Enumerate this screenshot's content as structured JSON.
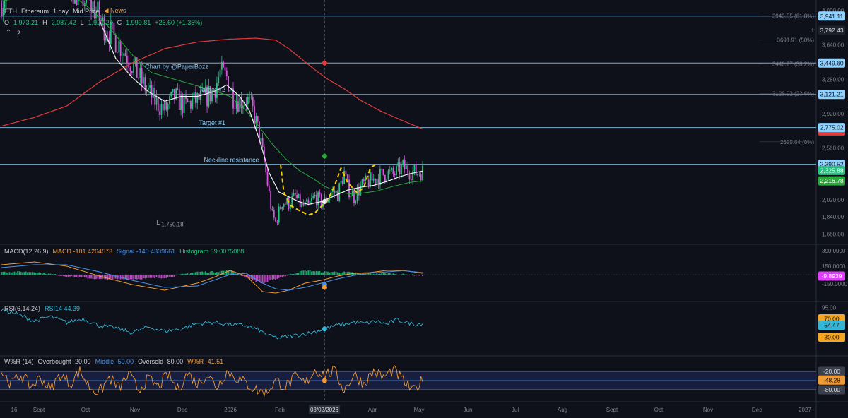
{
  "header": {
    "symbol": "ETH",
    "name": "Ethereum",
    "interval": "1 day",
    "price_type": "Mid Price",
    "news_label": "News",
    "ohlc": {
      "o_label": "O",
      "o": "1,973.21",
      "h_label": "H",
      "h": "2,087.42",
      "l_label": "L",
      "l": "1,921.24",
      "c_label": "C",
      "c": "1,999.81",
      "change": "+26.60 (+1.35%)"
    },
    "indicator_count": "2"
  },
  "macd": {
    "title": "MACD(12,26,9)",
    "macd_label": "MACD -101.4264573",
    "signal_label": "Signal -140.4339661",
    "hist_label": "Histogram 39.0075088"
  },
  "rsi": {
    "title": "RSI(6,14,24)",
    "value_label": "RSI14 44.39"
  },
  "wr": {
    "title": "W%R (14)",
    "overbought_label": "Overbought -20.00",
    "middle_label": "Middle -50.00",
    "oversold_label": "Oversold -80.00",
    "value_label": "W%R -41.51"
  },
  "colors": {
    "background": "#0f111a",
    "up": "#26c281",
    "down": "#d15ad6",
    "white_ma": "#f2f2f2",
    "green_ma": "#27a838",
    "red_ma": "#e23b3b",
    "macd": "#f09a36",
    "signal": "#4a90e2",
    "rsi": "#35b6d6",
    "wr": "#f09a36",
    "hline": "#8fc9ef",
    "pattern": "#f5d000"
  },
  "chart_data": [
    {
      "type": "candlestick",
      "title": "",
      "x_axis_labels": [
        "16",
        "Sept",
        "Oct",
        "Nov",
        "Dec",
        "2026",
        "Feb",
        "03/02/2026",
        "Apr",
        "May",
        "Jun",
        "Jul",
        "Aug",
        "Sept",
        "Oct",
        "Nov",
        "Dec",
        "2027"
      ],
      "crosshair_date": "03/02/2026",
      "y_tick_labels": [
        "4,000.00",
        "3,640.00",
        "3,280.00",
        "2,920.00",
        "2,560.00",
        "2,020.00",
        "1,840.00",
        "1,660.00"
      ],
      "ylim": [
        1560,
        4080
      ],
      "fib_levels": [
        {
          "label": "3943.55 (61.8%)",
          "value": 3943.55
        },
        {
          "label": "3691.91 (50%)",
          "value": 3691.91
        },
        {
          "label": "3440.27 (38.2%)",
          "value": 3440.27
        },
        {
          "label": "3128.92 (23.6%)",
          "value": 3128.92
        },
        {
          "label": "2625.64 (0%)",
          "value": 2625.64
        }
      ],
      "horizontal_levels": [
        {
          "value": 3941.11,
          "label": "3,941.11"
        },
        {
          "value": 3449.6,
          "label": "3,449.60"
        },
        {
          "value": 3121.21,
          "label": "3,121.21"
        },
        {
          "value": 2775.02,
          "label": "2,775.02"
        },
        {
          "value": 2390.52,
          "label": "2,390.52"
        }
      ],
      "price_tags": [
        {
          "value": 3792.43,
          "label": "3,792.43"
        },
        {
          "value": 2325.88,
          "label": "2,325.88"
        },
        {
          "value": 2216.78,
          "label": "2,216.78"
        }
      ],
      "annotations": [
        {
          "text": "Chart by @PaperBozz",
          "x_index": 88,
          "y": 3390
        },
        {
          "text": "Target #2",
          "x_index": 121,
          "y": 3150
        },
        {
          "text": "Target #1",
          "x_index": 121,
          "y": 2800
        },
        {
          "text": "Neckline resistance",
          "x_index": 124,
          "y": 2415
        },
        {
          "text": "1,750.18",
          "x_index": 98,
          "y": 1740
        }
      ],
      "x_months": [
        {
          "label": "16",
          "index": 0
        },
        {
          "label": "Sept",
          "index": 15
        },
        {
          "label": "Oct",
          "index": 45
        },
        {
          "label": "Nov",
          "index": 76
        },
        {
          "label": "Dec",
          "index": 106
        },
        {
          "label": "2026",
          "index": 137
        },
        {
          "label": "Feb",
          "index": 168
        },
        {
          "label": "Mar",
          "index": 196
        },
        {
          "label": "Apr",
          "index": 227
        },
        {
          "label": "May",
          "index": 257
        }
      ],
      "projection_months": [
        "Jun",
        "Jul",
        "Aug",
        "Sept",
        "Oct",
        "Nov",
        "Dec",
        "2027"
      ],
      "price_key_points": [
        [
          0,
          4100
        ],
        [
          8,
          4300
        ],
        [
          20,
          4450
        ],
        [
          30,
          4500
        ],
        [
          40,
          4300
        ],
        [
          48,
          4150
        ],
        [
          56,
          4050
        ],
        [
          62,
          3850
        ],
        [
          70,
          3700
        ],
        [
          78,
          3500
        ],
        [
          86,
          3250
        ],
        [
          94,
          3050
        ],
        [
          100,
          2950
        ],
        [
          106,
          3100
        ],
        [
          112,
          3000
        ],
        [
          118,
          3050
        ],
        [
          124,
          3080
        ],
        [
          130,
          3150
        ],
        [
          134,
          3350
        ],
        [
          138,
          3300
        ],
        [
          142,
          3100
        ],
        [
          146,
          3050
        ],
        [
          150,
          3080
        ],
        [
          154,
          2950
        ],
        [
          158,
          2700
        ],
        [
          162,
          2300
        ],
        [
          166,
          1850
        ],
        [
          168,
          1780
        ],
        [
          172,
          2000
        ],
        [
          176,
          1980
        ],
        [
          180,
          2050
        ],
        [
          184,
          1950
        ],
        [
          188,
          1950
        ],
        [
          192,
          2050
        ],
        [
          196,
          1990
        ],
        [
          198,
          2000
        ],
        [
          202,
          2100
        ],
        [
          206,
          2080
        ],
        [
          210,
          2300
        ],
        [
          212,
          2150
        ],
        [
          216,
          2050
        ],
        [
          220,
          2150
        ],
        [
          224,
          2200
        ],
        [
          230,
          2250
        ],
        [
          236,
          2300
        ],
        [
          240,
          2280
        ],
        [
          246,
          2360
        ],
        [
          250,
          2320
        ],
        [
          254,
          2300
        ],
        [
          258,
          2320
        ]
      ],
      "ma_white_key": [
        [
          60,
          3900
        ],
        [
          70,
          3500
        ],
        [
          80,
          3300
        ],
        [
          90,
          3150
        ],
        [
          100,
          3050
        ],
        [
          110,
          3100
        ],
        [
          120,
          3100
        ],
        [
          130,
          3150
        ],
        [
          138,
          3220
        ],
        [
          146,
          3100
        ],
        [
          152,
          2950
        ],
        [
          158,
          2650
        ],
        [
          164,
          2300
        ],
        [
          170,
          2100
        ],
        [
          176,
          2050
        ],
        [
          182,
          2000
        ],
        [
          188,
          1970
        ],
        [
          196,
          2000
        ],
        [
          204,
          2060
        ],
        [
          212,
          2120
        ],
        [
          220,
          2150
        ],
        [
          228,
          2170
        ],
        [
          236,
          2210
        ],
        [
          244,
          2260
        ],
        [
          250,
          2290
        ],
        [
          258,
          2320
        ]
      ],
      "ma_green_key": [
        [
          0,
          4100
        ],
        [
          20,
          4150
        ],
        [
          40,
          4200
        ],
        [
          52,
          4050
        ],
        [
          62,
          3900
        ],
        [
          72,
          3700
        ],
        [
          82,
          3500
        ],
        [
          92,
          3350
        ],
        [
          102,
          3300
        ],
        [
          112,
          3250
        ],
        [
          122,
          3200
        ],
        [
          132,
          3150
        ],
        [
          140,
          3100
        ],
        [
          150,
          2950
        ],
        [
          158,
          2780
        ],
        [
          166,
          2600
        ],
        [
          174,
          2450
        ],
        [
          182,
          2330
        ],
        [
          190,
          2250
        ],
        [
          198,
          2160
        ],
        [
          206,
          2100
        ],
        [
          214,
          2080
        ],
        [
          222,
          2090
        ],
        [
          230,
          2110
        ],
        [
          240,
          2160
        ],
        [
          250,
          2200
        ],
        [
          258,
          2217
        ]
      ],
      "ma_red_key": [
        [
          0,
          2790
        ],
        [
          20,
          2880
        ],
        [
          40,
          3000
        ],
        [
          60,
          3250
        ],
        [
          80,
          3450
        ],
        [
          100,
          3600
        ],
        [
          120,
          3670
        ],
        [
          140,
          3700
        ],
        [
          156,
          3710
        ],
        [
          168,
          3690
        ],
        [
          176,
          3600
        ],
        [
          184,
          3490
        ],
        [
          192,
          3380
        ],
        [
          200,
          3280
        ],
        [
          210,
          3180
        ],
        [
          220,
          3060
        ],
        [
          232,
          2950
        ],
        [
          244,
          2860
        ],
        [
          258,
          2760
        ]
      ],
      "pattern_points": [
        [
          171,
          2390
        ],
        [
          173,
          2100
        ],
        [
          177,
          1960
        ],
        [
          182,
          1910
        ],
        [
          188,
          1860
        ],
        [
          192,
          1880
        ],
        [
          196,
          1950
        ],
        [
          200,
          2020
        ],
        [
          204,
          2160
        ],
        [
          208,
          2350
        ],
        [
          212,
          2200
        ],
        [
          218,
          2090
        ],
        [
          222,
          2150
        ],
        [
          226,
          2350
        ],
        [
          230,
          2400
        ]
      ]
    },
    {
      "type": "line",
      "title": "MACD(12,26,9)",
      "ylim": [
        -180,
        180
      ],
      "y_tick_labels": [
        "390.0000",
        "150.0000",
        "-150.0000"
      ],
      "last_value_label": "-9.8939",
      "macd_key": [
        [
          0,
          70
        ],
        [
          20,
          90
        ],
        [
          40,
          60
        ],
        [
          60,
          -10
        ],
        [
          80,
          -70
        ],
        [
          100,
          -110
        ],
        [
          120,
          -60
        ],
        [
          130,
          -20
        ],
        [
          140,
          30
        ],
        [
          150,
          -10
        ],
        [
          160,
          -120
        ],
        [
          168,
          -130
        ],
        [
          176,
          -110
        ],
        [
          186,
          -60
        ],
        [
          196,
          -40
        ],
        [
          206,
          -10
        ],
        [
          216,
          10
        ],
        [
          226,
          15
        ],
        [
          236,
          30
        ],
        [
          246,
          30
        ],
        [
          258,
          10
        ]
      ],
      "signal_key": [
        [
          0,
          50
        ],
        [
          20,
          70
        ],
        [
          40,
          70
        ],
        [
          60,
          20
        ],
        [
          80,
          -40
        ],
        [
          100,
          -90
        ],
        [
          120,
          -80
        ],
        [
          130,
          -40
        ],
        [
          140,
          0
        ],
        [
          150,
          10
        ],
        [
          160,
          -60
        ],
        [
          168,
          -100
        ],
        [
          176,
          -110
        ],
        [
          186,
          -90
        ],
        [
          196,
          -60
        ],
        [
          206,
          -30
        ],
        [
          216,
          -5
        ],
        [
          226,
          10
        ],
        [
          236,
          20
        ],
        [
          246,
          28
        ],
        [
          258,
          15
        ]
      ],
      "marker_value": -70
    },
    {
      "type": "line",
      "title": "RSI(6,14,24)",
      "ylim": [
        0,
        100
      ],
      "y_tick_labels": [
        "95.00"
      ],
      "levels": [
        {
          "value": 70,
          "label": "70.00"
        },
        {
          "value": 30,
          "label": "30.00"
        }
      ],
      "last_value_label": "54.47",
      "rsi_key": [
        [
          0,
          90
        ],
        [
          10,
          80
        ],
        [
          20,
          65
        ],
        [
          30,
          75
        ],
        [
          40,
          62
        ],
        [
          50,
          70
        ],
        [
          60,
          55
        ],
        [
          70,
          50
        ],
        [
          80,
          40
        ],
        [
          90,
          52
        ],
        [
          100,
          43
        ],
        [
          110,
          48
        ],
        [
          120,
          60
        ],
        [
          130,
          62
        ],
        [
          140,
          58
        ],
        [
          150,
          55
        ],
        [
          158,
          45
        ],
        [
          164,
          33
        ],
        [
          170,
          28
        ],
        [
          176,
          32
        ],
        [
          182,
          35
        ],
        [
          190,
          40
        ],
        [
          198,
          48
        ],
        [
          204,
          55
        ],
        [
          210,
          58
        ],
        [
          216,
          63
        ],
        [
          222,
          60
        ],
        [
          230,
          65
        ],
        [
          236,
          58
        ],
        [
          242,
          68
        ],
        [
          248,
          62
        ],
        [
          254,
          58
        ],
        [
          258,
          60
        ]
      ]
    },
    {
      "type": "line",
      "title": "W%R (14)",
      "ylim": [
        -100,
        0
      ],
      "levels": [
        {
          "value": -20,
          "label": "-20.00"
        },
        {
          "value": -50,
          "label": "-50.00"
        },
        {
          "value": -80,
          "label": "-80.00"
        }
      ],
      "last_value_label": "-48.28",
      "wr_key": [
        [
          0,
          -20
        ],
        [
          6,
          -60
        ],
        [
          12,
          -30
        ],
        [
          18,
          -70
        ],
        [
          24,
          -40
        ],
        [
          30,
          -80
        ],
        [
          36,
          -30
        ],
        [
          42,
          -60
        ],
        [
          48,
          -20
        ],
        [
          54,
          -70
        ],
        [
          60,
          -90
        ],
        [
          66,
          -40
        ],
        [
          72,
          -75
        ],
        [
          78,
          -30
        ],
        [
          84,
          -80
        ],
        [
          90,
          -45
        ],
        [
          96,
          -70
        ],
        [
          102,
          -30
        ],
        [
          108,
          -80
        ],
        [
          114,
          -25
        ],
        [
          120,
          -60
        ],
        [
          126,
          -30
        ],
        [
          132,
          -70
        ],
        [
          138,
          -20
        ],
        [
          144,
          -40
        ],
        [
          150,
          -60
        ],
        [
          156,
          -80
        ],
        [
          162,
          -90
        ],
        [
          168,
          -50
        ],
        [
          174,
          -70
        ],
        [
          180,
          -40
        ],
        [
          186,
          -60
        ],
        [
          192,
          -15
        ],
        [
          198,
          -30
        ],
        [
          204,
          -20
        ],
        [
          210,
          -80
        ],
        [
          216,
          -30
        ],
        [
          222,
          -60
        ],
        [
          228,
          -20
        ],
        [
          234,
          -40
        ],
        [
          240,
          -15
        ],
        [
          246,
          -50
        ],
        [
          252,
          -85
        ],
        [
          258,
          -48
        ]
      ]
    }
  ]
}
